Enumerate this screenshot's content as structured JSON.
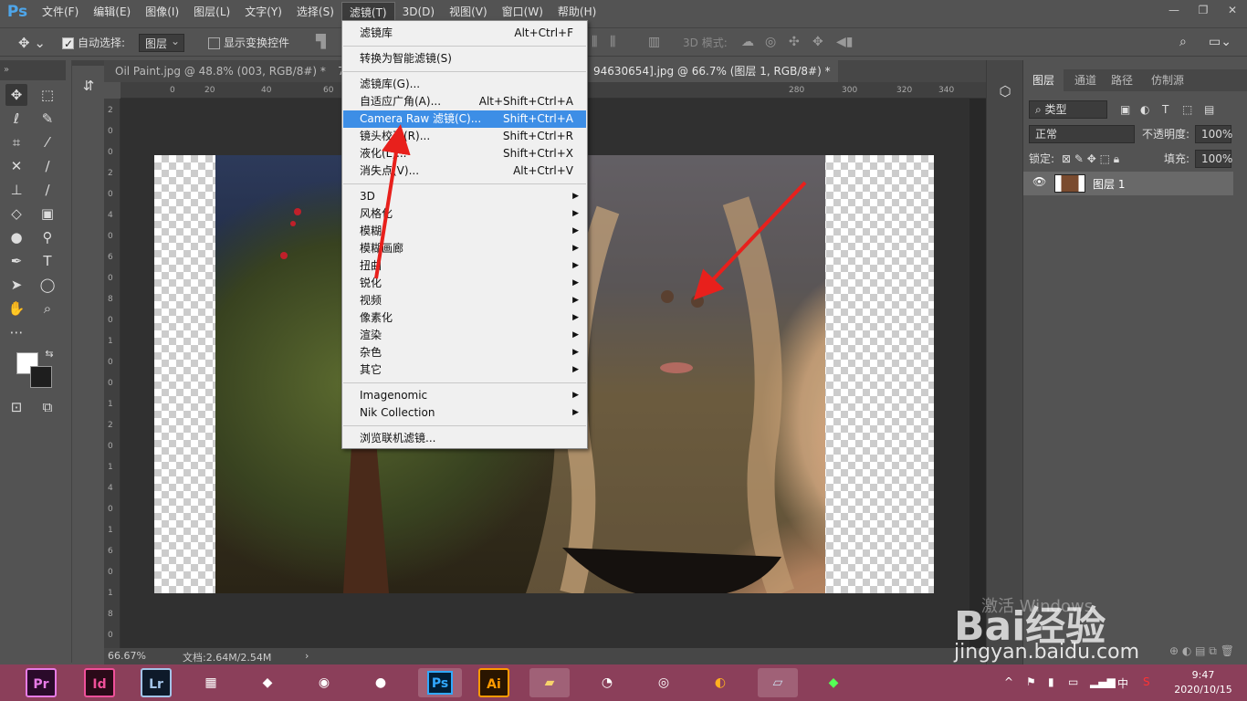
{
  "menubar": {
    "logo": "Ps",
    "items": [
      "文件(F)",
      "编辑(E)",
      "图像(I)",
      "图层(L)",
      "文字(Y)",
      "选择(S)",
      "滤镜(T)",
      "3D(D)",
      "视图(V)",
      "窗口(W)",
      "帮助(H)"
    ],
    "active": "滤镜(T)"
  },
  "options": {
    "auto_select_label": "自动选择:",
    "auto_select_value": "图层",
    "show_transform_label": "显示变换控件",
    "mode_3d_label": "3D 模式:"
  },
  "tabs": [
    {
      "label": "Oil Paint.jpg @ 48.8% (003, RGB/8#) *",
      "active": false
    },
    {
      "label": "7",
      "active": false
    },
    {
      "label": "94630654].jpg @ 66.7% (图层 1, RGB/8#) *",
      "active": true
    }
  ],
  "ruler_h": [
    "0",
    "20",
    "40",
    "60",
    "280",
    "300",
    "320",
    "340"
  ],
  "ruler_v": [
    "2",
    "0",
    "0",
    "2",
    "0",
    "4",
    "0",
    "6",
    "0",
    "8",
    "0",
    "1",
    "0",
    "0",
    "1",
    "2",
    "0",
    "1",
    "4",
    "0",
    "1",
    "6",
    "0",
    "1",
    "8",
    "0"
  ],
  "filter_menu": {
    "items": [
      {
        "label": "滤镜库",
        "shortcut": "Alt+Ctrl+F"
      },
      {
        "sep": true
      },
      {
        "label": "转换为智能滤镜(S)"
      },
      {
        "sep": true
      },
      {
        "label": "滤镜库(G)..."
      },
      {
        "label": "自适应广角(A)...",
        "shortcut": "Alt+Shift+Ctrl+A"
      },
      {
        "label": "Camera Raw 滤镜(C)...",
        "shortcut": "Shift+Ctrl+A",
        "highlight": true
      },
      {
        "label": "镜头校正(R)...",
        "shortcut": "Shift+Ctrl+R"
      },
      {
        "label": "液化(L)...",
        "shortcut": "Shift+Ctrl+X"
      },
      {
        "label": "消失点(V)...",
        "shortcut": "Alt+Ctrl+V"
      },
      {
        "sep": true
      },
      {
        "label": "3D",
        "submenu": true
      },
      {
        "label": "风格化",
        "submenu": true
      },
      {
        "label": "模糊",
        "submenu": true
      },
      {
        "label": "模糊画廊",
        "submenu": true
      },
      {
        "label": "扭曲",
        "submenu": true
      },
      {
        "label": "锐化",
        "submenu": true
      },
      {
        "label": "视频",
        "submenu": true
      },
      {
        "label": "像素化",
        "submenu": true
      },
      {
        "label": "渲染",
        "submenu": true
      },
      {
        "label": "杂色",
        "submenu": true
      },
      {
        "label": "其它",
        "submenu": true
      },
      {
        "sep": true
      },
      {
        "label": "Imagenomic",
        "submenu": true
      },
      {
        "label": "Nik Collection",
        "submenu": true
      },
      {
        "sep": true
      },
      {
        "label": "浏览联机滤镜..."
      }
    ]
  },
  "status": {
    "zoom": "66.67%",
    "doc": "文档:2.64M/2.54M"
  },
  "layers_panel": {
    "tabs": [
      "图层",
      "通道",
      "路径",
      "仿制源"
    ],
    "kind_filter": "类型",
    "blend_mode": "正常",
    "opacity_label": "不透明度:",
    "opacity_value": "100%",
    "lock_label": "锁定:",
    "fill_label": "填充:",
    "fill_value": "100%",
    "layer_name": "图层 1"
  },
  "taskbar": {
    "apps": [
      "Pr",
      "Id",
      "Lr",
      "Ps",
      "Ai"
    ],
    "time": "9:47",
    "date": "2020/10/15",
    "ime": "中"
  },
  "watermark": {
    "logo": "Bai经验",
    "url": "jingyan.baidu.com",
    "activate": "激活 Windows"
  },
  "colors": {
    "accent": "#3d8ee6",
    "arrow": "#e8201c",
    "taskbar": "#8b3f5a"
  }
}
